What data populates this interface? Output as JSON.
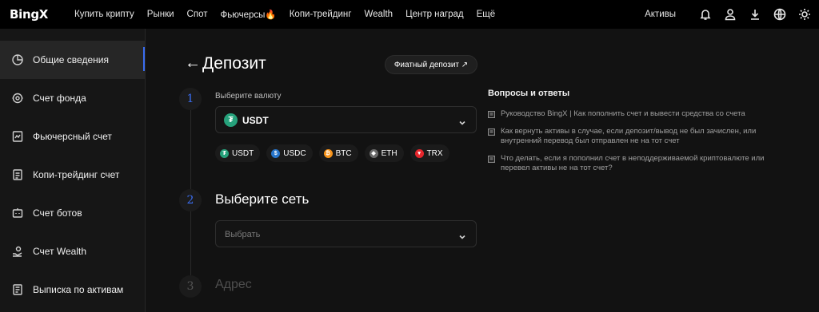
{
  "header": {
    "logo": "BingX",
    "nav": [
      "Купить крипту",
      "Рынки",
      "Спот",
      "Фьючерсы🔥",
      "Копи-трейдинг",
      "Wealth",
      "Центр наград",
      "Ещё"
    ],
    "assets_label": "Активы",
    "icons": [
      "bell-icon",
      "user-icon",
      "download-icon",
      "globe-icon",
      "theme-icon"
    ]
  },
  "sidebar": {
    "items": [
      {
        "label": "Общие сведения",
        "icon": "pie-chart-icon",
        "active": true
      },
      {
        "label": "Счет фонда",
        "icon": "fund-icon"
      },
      {
        "label": "Фьючерсный счет",
        "icon": "futures-icon"
      },
      {
        "label": "Копи-трейдинг счет",
        "icon": "copy-icon"
      },
      {
        "label": "Счет ботов",
        "icon": "bot-icon"
      },
      {
        "label": "Счет Wealth",
        "icon": "wealth-icon"
      },
      {
        "label": "Выписка по активам",
        "icon": "statement-icon"
      }
    ]
  },
  "main": {
    "back_glyph": "←",
    "title": "Депозит",
    "fiat_button": "Фиатный депозит ↗",
    "step1": {
      "number": "1",
      "label": "Выберите валюту",
      "selected": "USDT",
      "chips": [
        "USDT",
        "USDC",
        "BTC",
        "ETH",
        "TRX"
      ]
    },
    "step2": {
      "number": "2",
      "title": "Выберите сеть",
      "placeholder": "Выбрать"
    },
    "step3": {
      "number": "3",
      "title": "Адрес"
    }
  },
  "faq": {
    "title": "Вопросы и ответы",
    "items": [
      "Руководство BingX | Как пополнить счет и вывести средства со счета",
      "Как вернуть активы в случае, если депозит/вывод не был зачислен, или внутренний перевод был отправлен не на тот счет",
      "Что делать, если я пополнил счет в неподдерживаемой криптовалюте или перевел активы не на тот счет?"
    ]
  },
  "colors": {
    "accent": "#3a6df0",
    "usdt": "#26a17b",
    "usdc": "#2775ca",
    "btc": "#f7931a",
    "eth": "#6b6b6b",
    "trx": "#e5262c"
  }
}
